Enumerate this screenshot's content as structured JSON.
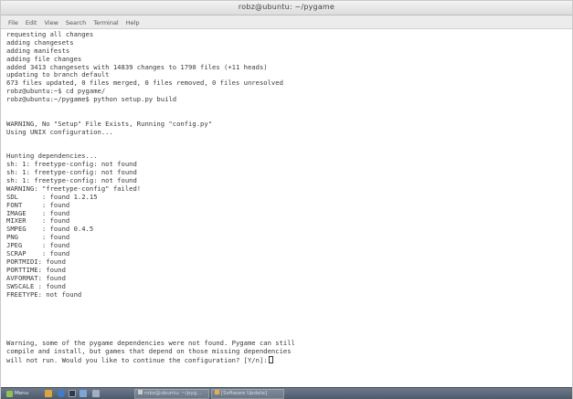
{
  "window": {
    "title": "robz@ubuntu: ~/pygame"
  },
  "menubar": [
    "File",
    "Edit",
    "View",
    "Search",
    "Terminal",
    "Help"
  ],
  "terminal": {
    "lines": [
      "requesting all changes",
      "adding changesets",
      "adding manifests",
      "adding file changes",
      "added 3413 changesets with 14839 changes to 1790 files (+11 heads)",
      "updating to branch default",
      "673 files updated, 0 files merged, 0 files removed, 0 files unresolved",
      "robz@ubuntu:~$ cd pygame/",
      "robz@ubuntu:~/pygame$ python setup.py build",
      "",
      "",
      "WARNING, No \"Setup\" File Exists, Running \"config.py\"",
      "Using UNIX configuration...",
      "",
      "",
      "Hunting dependencies...",
      "sh: 1: freetype-config: not found",
      "sh: 1: freetype-config: not found",
      "sh: 1: freetype-config: not found",
      "WARNING: \"freetype-config\" failed!",
      "SDL      : found 1.2.15",
      "FONT     : found",
      "IMAGE    : found",
      "MIXER    : found",
      "SMPEG    : found 0.4.5",
      "PNG      : found",
      "JPEG     : found",
      "SCRAP    : found",
      "PORTMIDI: found",
      "PORTTIME: found",
      "AVFORMAT: found",
      "SWSCALE : found",
      "FREETYPE: not found",
      "",
      "",
      "",
      "",
      "",
      "Warning, some of the pygame dependencies were not found. Pygame can still",
      "compile and install, but games that depend on those missing dependencies",
      "will not run. Would you like to continue the configuration? [Y/n]:"
    ]
  },
  "taskbar": {
    "menu_label": "Menu",
    "tasks": [
      "robz@ubuntu: ~/pyg...",
      "[Software Update]"
    ]
  },
  "colors": {
    "terminal_bg": "#ffffff",
    "terminal_fg": "#3a3a3a",
    "taskbar": "#5b6778"
  }
}
